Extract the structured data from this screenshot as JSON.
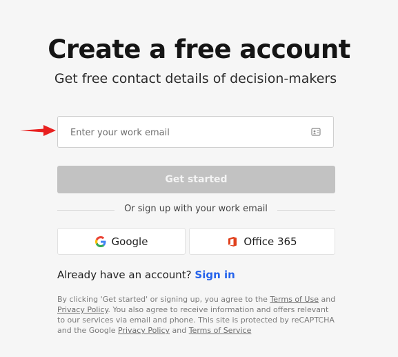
{
  "header": {
    "title": "Create a free account",
    "subtitle": "Get free contact details of decision-makers"
  },
  "email": {
    "placeholder": "Enter your work email",
    "value": ""
  },
  "primary_button": {
    "label": "Get started"
  },
  "divider": {
    "text": "Or sign up with your work email"
  },
  "sso": {
    "google_label": "Google",
    "office_label": "Office 365"
  },
  "signin": {
    "prompt": "Already have an account?",
    "link_label": "Sign in"
  },
  "legal": {
    "part1": "By clicking 'Get started' or signing up, you agree to the ",
    "terms_of_use": "Terms of Use",
    "part2": " and ",
    "privacy_policy_1": "Privacy Policy",
    "part3": ". You also agree to receive information and offers relevant to our services via email and phone. This site is protected by reCAPTCHA and the Google ",
    "privacy_policy_2": "Privacy Policy",
    "part4": " and ",
    "terms_of_service": "Terms of Service"
  },
  "colors": {
    "accent_link": "#2563eb",
    "arrow": "#e8201f",
    "disabled_button": "#c2c2c2"
  },
  "icons": {
    "arrow": "arrow-right-icon",
    "autofill": "contact-card-icon",
    "google": "google-logo-icon",
    "office": "office-logo-icon"
  }
}
